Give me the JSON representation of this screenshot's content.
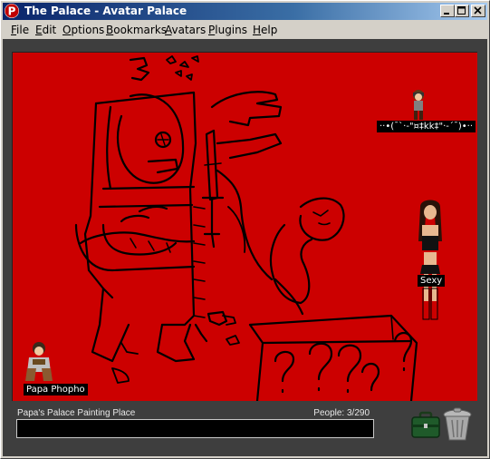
{
  "window": {
    "title": "The Palace - Avatar Palace"
  },
  "menu": {
    "items": [
      {
        "label": "File"
      },
      {
        "label": "Edit"
      },
      {
        "label": "Options"
      },
      {
        "label": "Bookmarks"
      },
      {
        "label": "Avatars"
      },
      {
        "label": "Plugins"
      },
      {
        "label": "Help"
      }
    ]
  },
  "room": {
    "background_color": "#cc0000",
    "users": [
      {
        "name": "··•(¯`·-\"¤‡kk‡\"·-´¯)•··"
      },
      {
        "name": "Sexy"
      },
      {
        "name": "Papa Phopho"
      }
    ]
  },
  "status": {
    "room_name": "Papa's Palace Painting Place",
    "people": "People: 3/290"
  },
  "chat": {
    "value": "",
    "placeholder": ""
  },
  "icons": {
    "app": "palace-logo-icon",
    "briefcase": "briefcase-props-icon",
    "trash": "trash-can-icon"
  },
  "colors": {
    "titlebar_start": "#0a246a",
    "titlebar_end": "#a6caf0",
    "room_bg": "#cc0000",
    "frame_bg": "#3e3e3e"
  }
}
